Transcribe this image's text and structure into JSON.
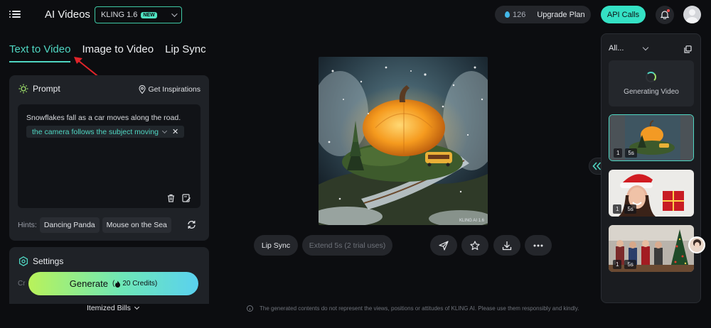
{
  "header": {
    "app_title": "AI Videos",
    "model": "KLING 1.6",
    "model_badge": "NEW",
    "credit_count": "126",
    "upgrade_label": "Upgrade Plan",
    "api_label": "API Calls"
  },
  "tabs": [
    {
      "label": "Text to Video",
      "active": true
    },
    {
      "label": "Image to Video",
      "active": false
    },
    {
      "label": "Lip Sync",
      "active": false
    }
  ],
  "prompt": {
    "title": "Prompt",
    "inspirations_label": "Get Inspirations",
    "text": "Snowflakes fall as a car moves along the road.",
    "camera_chip": "the camera follows the subject moving",
    "hints_label": "Hints:",
    "hints": [
      "Dancing Panda",
      "Mouse on the Sea"
    ]
  },
  "settings": {
    "title": "Settings",
    "cut_text": "Cr"
  },
  "generate": {
    "label": "Generate",
    "credits": "20 Credits"
  },
  "itemized_label": "Itemized Bills",
  "actions": {
    "lip_sync": "Lip Sync",
    "extend": "Extend 5s",
    "extend_note": "(2 trial uses)"
  },
  "preview": {
    "watermark": "KLING AI 1.6"
  },
  "disclaimer": "The generated contents do not represent the views, positions or attitudes of KLING AI. Please use them responsibly and kindly.",
  "history": {
    "filter_label": "All...",
    "generating_label": "Generating Video",
    "items": [
      {
        "count": "1",
        "duration": "5s",
        "subject": "pumpkin house",
        "selected": true
      },
      {
        "count": "1",
        "duration": "5s",
        "subject": "santa hat woman",
        "selected": false
      },
      {
        "count": "1",
        "duration": "5s",
        "subject": "christmas party",
        "selected": false
      }
    ]
  },
  "colors": {
    "accent": "#4fd6c2",
    "api_button": "#34e1c4",
    "background": "#0c0d10",
    "card": "#1f2227"
  }
}
